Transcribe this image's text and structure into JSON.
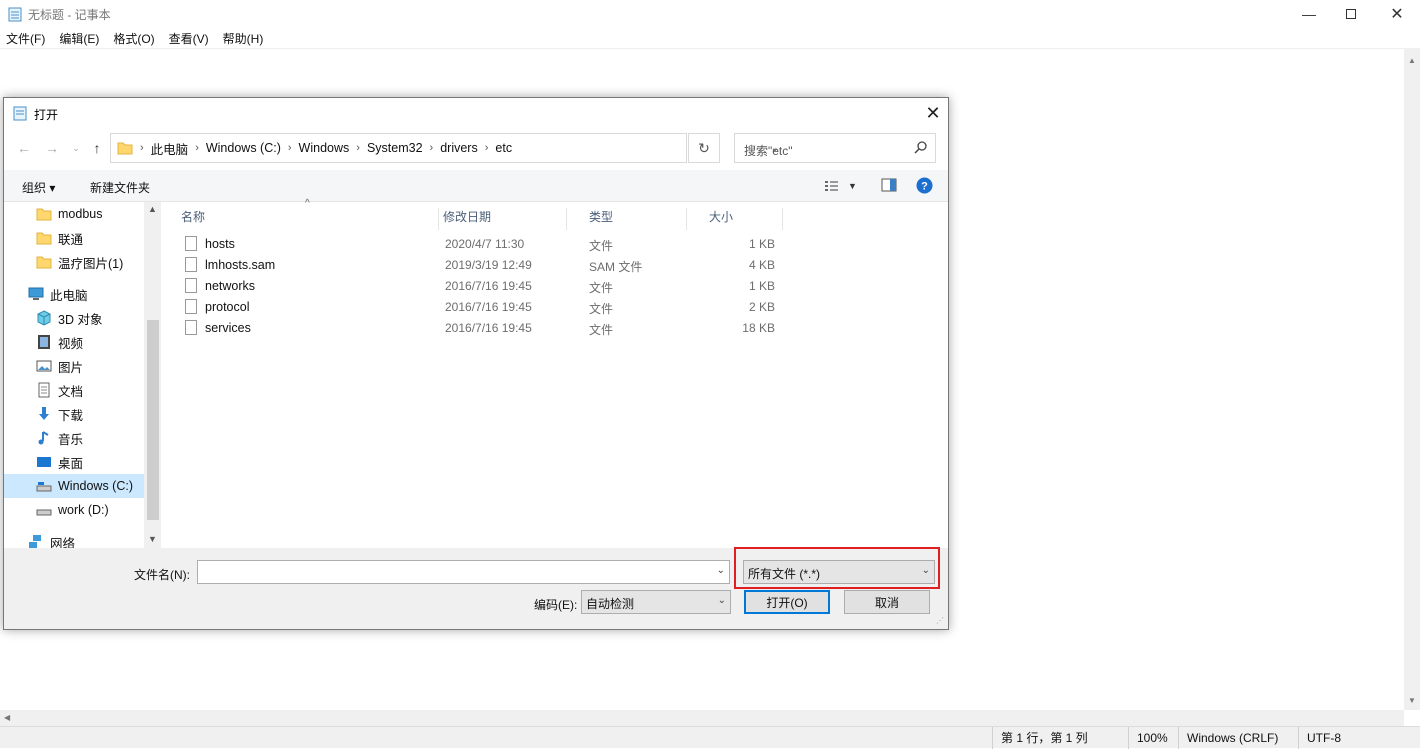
{
  "notepad": {
    "title": "无标题 - 记事本",
    "menu": [
      "文件(F)",
      "编辑(E)",
      "格式(O)",
      "查看(V)",
      "帮助(H)"
    ],
    "status": {
      "position": "第 1 行，第 1 列",
      "zoom": "100%",
      "line_ending": "Windows (CRLF)",
      "encoding": "UTF-8"
    }
  },
  "dialog": {
    "title": "打开",
    "breadcrumb": [
      "此电脑",
      "Windows (C:)",
      "Windows",
      "System32",
      "drivers",
      "etc"
    ],
    "search_placeholder": "搜索\"etc\"",
    "toolbar": {
      "organize": "组织 ▾",
      "new_folder": "新建文件夹"
    },
    "nav_items": [
      {
        "label": "modbus",
        "icon": "folder-icon"
      },
      {
        "label": "联通",
        "icon": "folder-icon"
      },
      {
        "label": "温疗图片(1)",
        "icon": "folder-icon"
      },
      {
        "label": "此电脑",
        "icon": "computer-icon"
      },
      {
        "label": "3D 对象",
        "icon": "cube-icon"
      },
      {
        "label": "视频",
        "icon": "video-icon"
      },
      {
        "label": "图片",
        "icon": "pictures-icon"
      },
      {
        "label": "文档",
        "icon": "document-icon"
      },
      {
        "label": "下载",
        "icon": "download-icon"
      },
      {
        "label": "音乐",
        "icon": "music-icon"
      },
      {
        "label": "桌面",
        "icon": "desktop-icon"
      },
      {
        "label": "Windows (C:)",
        "icon": "drive-icon"
      },
      {
        "label": "work (D:)",
        "icon": "drive-icon"
      },
      {
        "label": "网络",
        "icon": "network-icon"
      }
    ],
    "columns": [
      "名称",
      "修改日期",
      "类型",
      "大小"
    ],
    "files": [
      {
        "name": "hosts",
        "date": "2020/4/7 11:30",
        "type": "文件",
        "size": "1 KB"
      },
      {
        "name": "lmhosts.sam",
        "date": "2019/3/19 12:49",
        "type": "SAM 文件",
        "size": "4 KB"
      },
      {
        "name": "networks",
        "date": "2016/7/16 19:45",
        "type": "文件",
        "size": "1 KB"
      },
      {
        "name": "protocol",
        "date": "2016/7/16 19:45",
        "type": "文件",
        "size": "2 KB"
      },
      {
        "name": "services",
        "date": "2016/7/16 19:45",
        "type": "文件",
        "size": "18 KB"
      }
    ],
    "filename_label": "文件名(N):",
    "filename_value": "",
    "filetype_value": "所有文件  (*.*)",
    "encoding_label": "编码(E):",
    "encoding_value": "自动检测",
    "open_button": "打开(O)",
    "cancel_button": "取消"
  },
  "colors": {
    "selection": "#cce8ff",
    "accent": "#0078d7",
    "highlight_box": "#e02020"
  }
}
